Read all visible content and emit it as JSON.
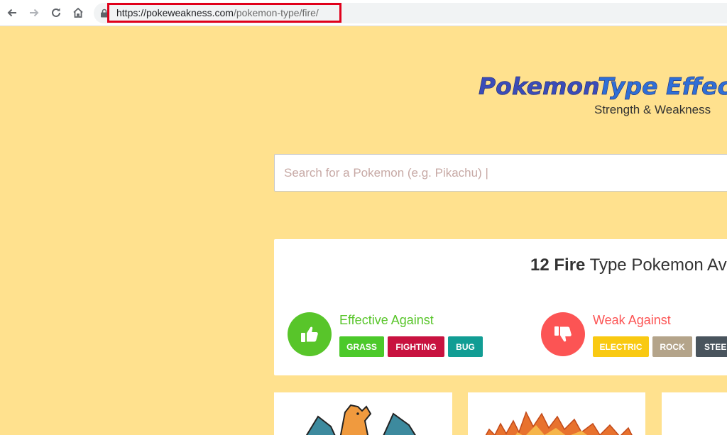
{
  "browser": {
    "url_domain": "https://pokeweakness.com",
    "url_path": "/pokemon-type/fire/"
  },
  "header": {
    "logo_text_1": "Pokemon",
    "logo_text_2": "Type Effec",
    "subtitle": "Strength & Weakness"
  },
  "search": {
    "placeholder": "Search for a Pokemon (e.g. Pikachu) |"
  },
  "summary": {
    "count_type": "12 Fire",
    "rest": " Type Pokemon Av"
  },
  "effective": {
    "label": "Effective Against",
    "badges": [
      "GRASS",
      "FIGHTING",
      "BUG"
    ]
  },
  "weak": {
    "label": "Weak Against",
    "badges": [
      "ELECTRIC",
      "ROCK",
      "STEE"
    ]
  },
  "colors": {
    "page_bg": "#FFE18E",
    "good": "#58c52a",
    "bad": "#fc5454",
    "grass": "#4cc92a",
    "fighting": "#c8123f",
    "bug": "#119d94",
    "electric": "#f9c912",
    "rock": "#b4a48a",
    "steel": "#49545d",
    "url_highlight": "#e0001b"
  },
  "icons": [
    "back-arrow-icon",
    "forward-arrow-icon",
    "reload-icon",
    "home-icon",
    "lock-icon",
    "thumbs-up-icon",
    "thumbs-down-icon"
  ]
}
